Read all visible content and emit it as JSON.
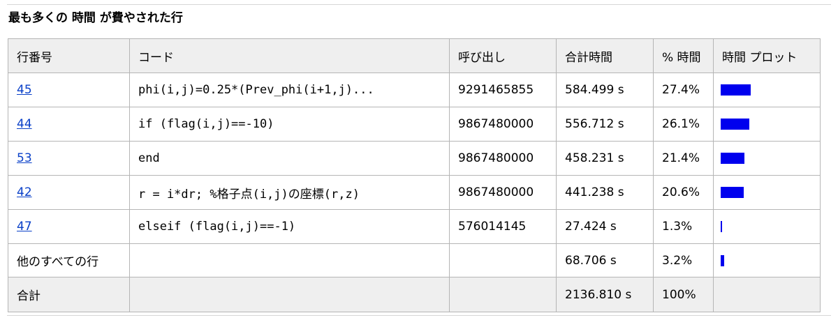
{
  "section": {
    "title": "最も多くの 時間 が費やされた行"
  },
  "table": {
    "headers": {
      "line": "行番号",
      "code": "コード",
      "calls": "呼び出し",
      "total_time": "合計時間",
      "percent_time": "% 時間",
      "time_plot": "時間 プロット"
    },
    "rows": [
      {
        "line": "45",
        "code": "phi(i,j)=0.25*(Prev_phi(i+1,j)...",
        "calls": "9291465855",
        "total_time": "584.499 s",
        "percent_time": "27.4%",
        "percent_value": 27.4
      },
      {
        "line": "44",
        "code": "if (flag(i,j)==-10)",
        "calls": "9867480000",
        "total_time": "556.712 s",
        "percent_time": "26.1%",
        "percent_value": 26.1
      },
      {
        "line": "53",
        "code": "end",
        "calls": "9867480000",
        "total_time": "458.231 s",
        "percent_time": "21.4%",
        "percent_value": 21.4
      },
      {
        "line": "42",
        "code": "r = i*dr; %格子点(i,j)の座標(r,z)",
        "calls": "9867480000",
        "total_time": "441.238 s",
        "percent_time": "20.6%",
        "percent_value": 20.6
      },
      {
        "line": "47",
        "code": "elseif (flag(i,j)==-1)",
        "calls": "576014145",
        "total_time": "27.424 s",
        "percent_time": "1.3%",
        "percent_value": 1.3
      }
    ],
    "other": {
      "label": "他のすべての行",
      "total_time": "68.706 s",
      "percent_time": "3.2%",
      "percent_value": 3.2
    },
    "total": {
      "label": "合計",
      "total_time": "2136.810 s",
      "percent_time": "100%"
    }
  },
  "colors": {
    "bar": "#0000ee",
    "link": "#0a40c8",
    "header_bg": "#efefef",
    "border": "#b5b5b5"
  }
}
